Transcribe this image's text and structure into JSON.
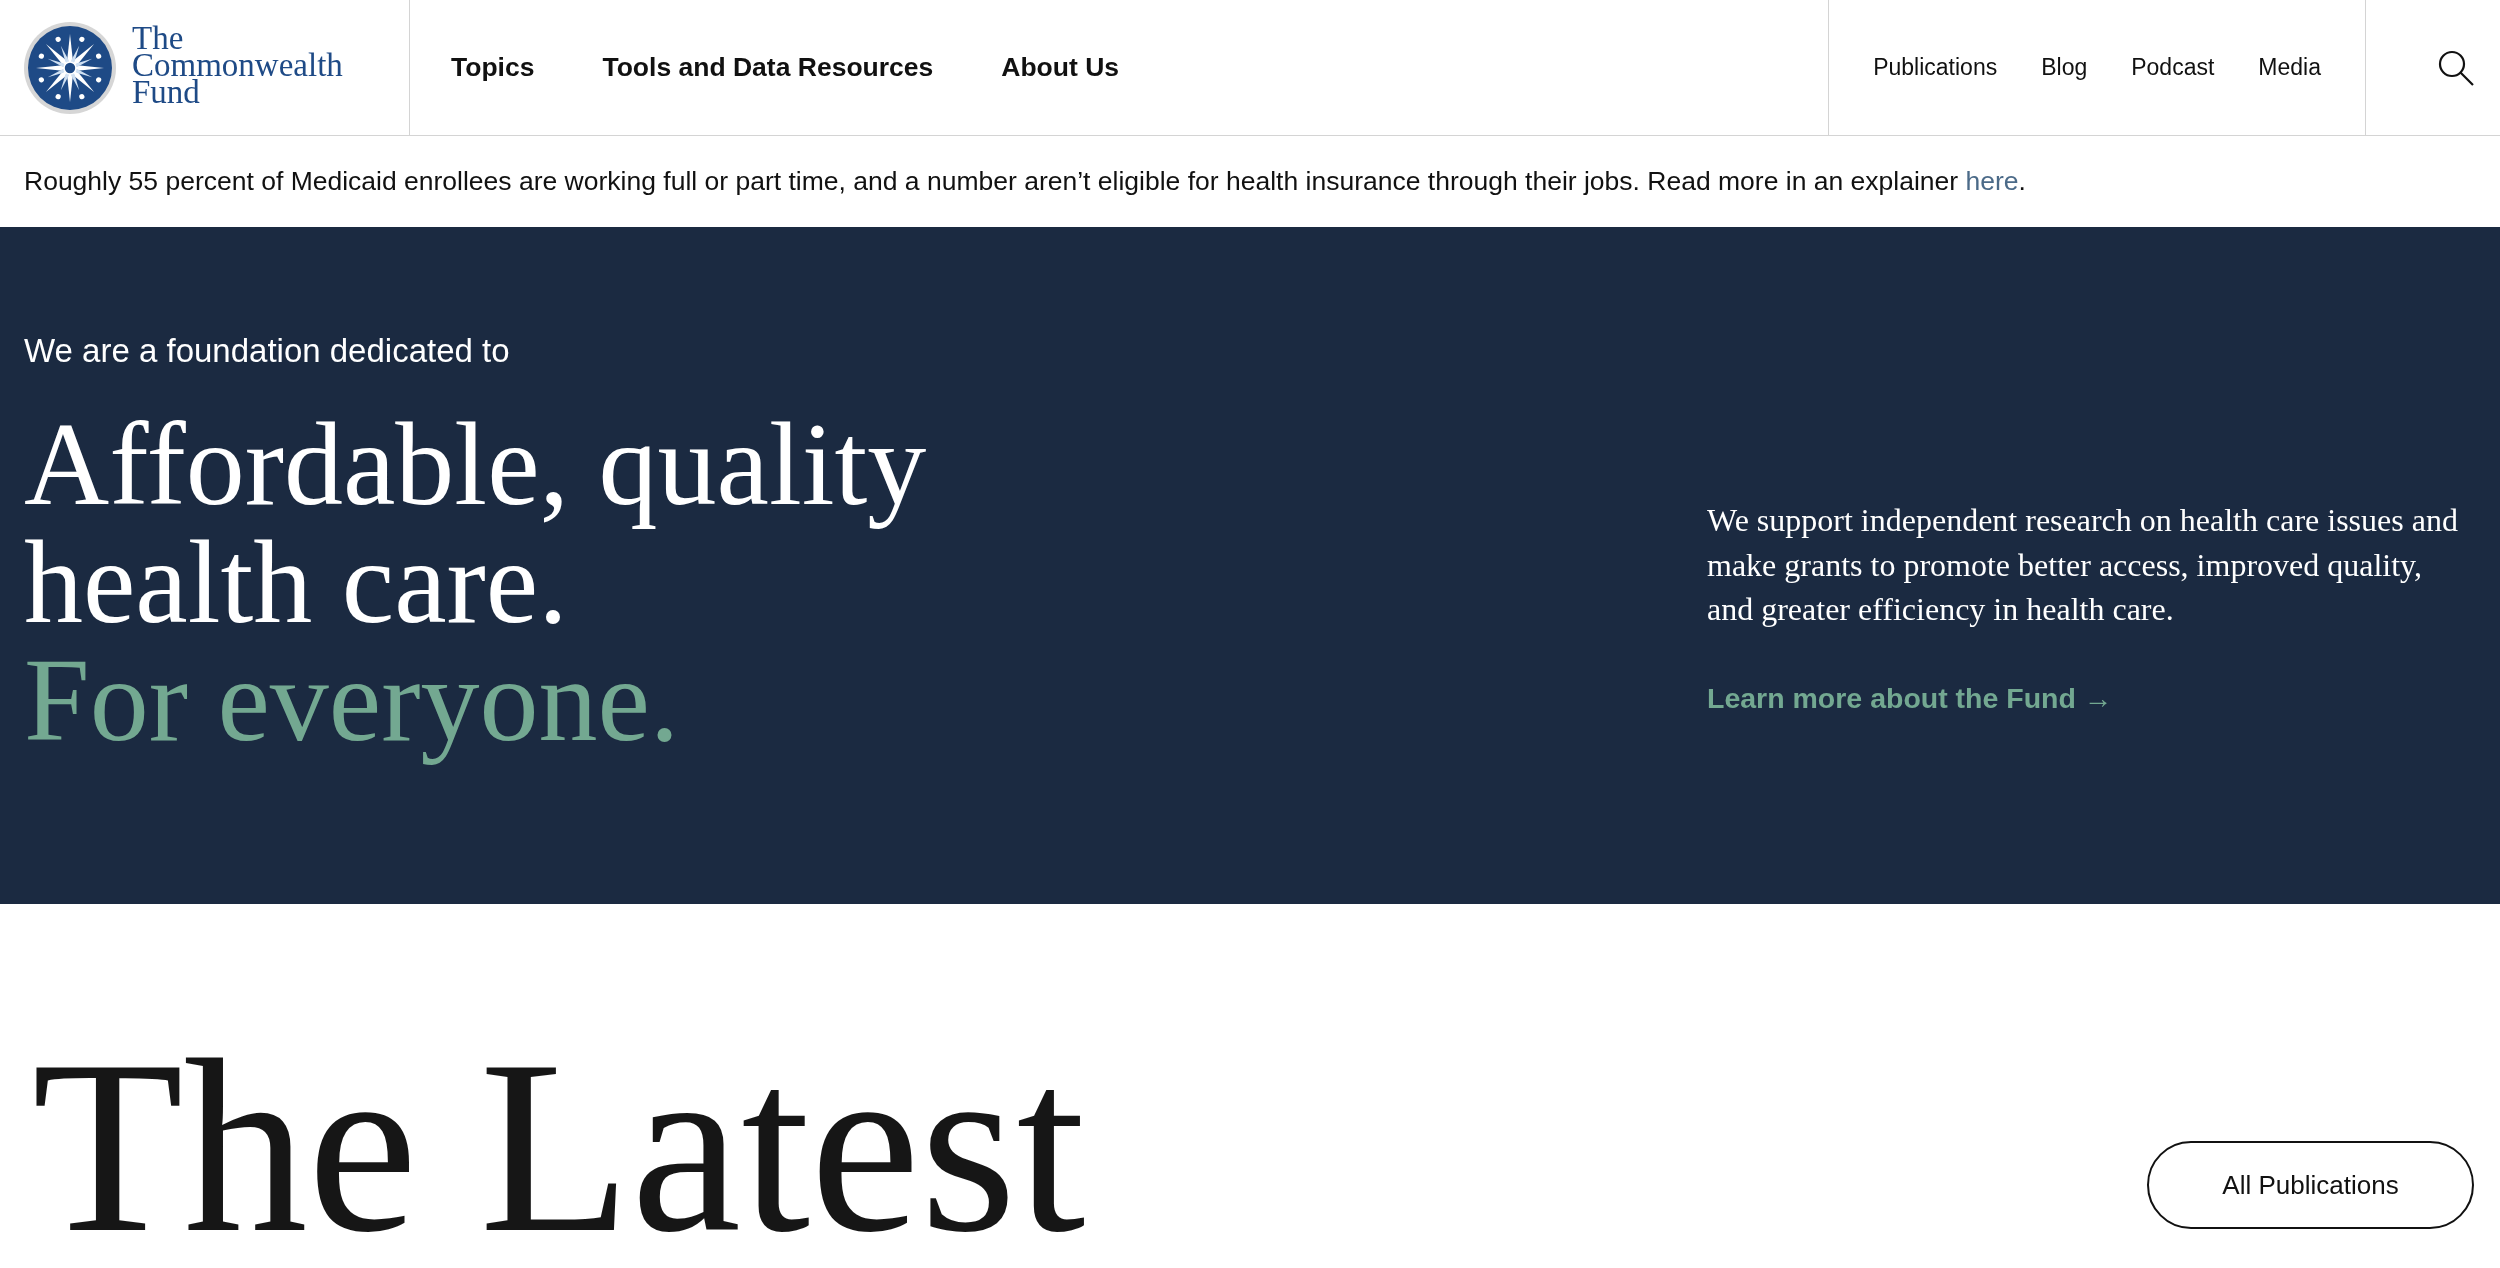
{
  "header": {
    "logo": {
      "lines": [
        "The",
        "Commonwealth",
        "Fund"
      ]
    },
    "main_nav": [
      "Topics",
      "Tools and Data Resources",
      "About Us"
    ],
    "utility_nav": [
      "Publications",
      "Blog",
      "Podcast",
      "Media"
    ]
  },
  "announcement": {
    "text": "Roughly 55 percent of Medicaid enrollees are working full or part time, and a number aren’t eligible for health insurance through their jobs. Read more in an explainer",
    "link": "here",
    "end": "."
  },
  "hero": {
    "intro": "We are a foundation dedicated to",
    "headline": "Affordable, quality health care.",
    "tagline": "For everyone.",
    "description": "We support independent research on health care issues and make grants to promote better access, improved quality, and greater efficiency in health care.",
    "link": "Learn more about the Fund →"
  },
  "latest": {
    "title": "The Latest",
    "button": "All Publications"
  }
}
